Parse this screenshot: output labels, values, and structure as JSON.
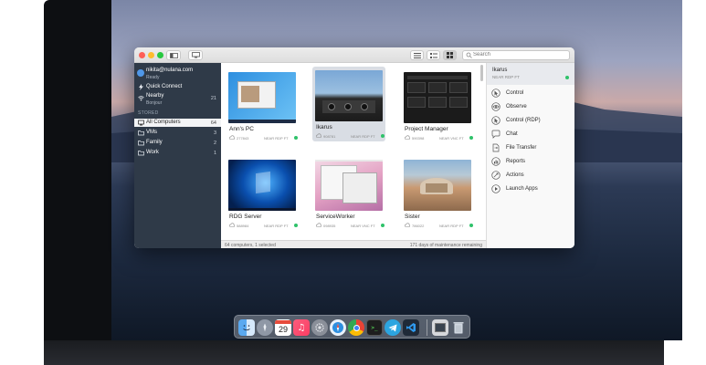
{
  "window": {
    "search_placeholder": "Search"
  },
  "sidebar": {
    "account": {
      "email": "nikita@nulana.com",
      "status": "Ready"
    },
    "quick_connect": "Quick Connect",
    "nearby": {
      "label": "Nearby",
      "sub": "Bonjour",
      "count": "21"
    },
    "section_label": "STORED",
    "items": [
      {
        "label": "All Computers",
        "count": "64",
        "selected": true
      },
      {
        "label": "VMs",
        "count": "3",
        "selected": false
      },
      {
        "label": "Family",
        "count": "2",
        "selected": false
      },
      {
        "label": "Work",
        "count": "1",
        "selected": false
      }
    ]
  },
  "computers": [
    {
      "name": "Ann's PC",
      "id": "277843",
      "connection": "NEAR RDP FT",
      "selected": false
    },
    {
      "name": "Ikarus",
      "id": "908781",
      "connection": "NEAR RDP FT",
      "selected": true
    },
    {
      "name": "Project Manager",
      "id": "590398",
      "connection": "NEAR VNC FT",
      "selected": false
    },
    {
      "name": "RDG Server",
      "id": "588984",
      "connection": "NEAR RDP FT",
      "selected": false
    },
    {
      "name": "ServiceWorker",
      "id": "098935",
      "connection": "NEAR VNC FT",
      "selected": false
    },
    {
      "name": "Sister",
      "id": "786022",
      "connection": "NEAR RDP FT",
      "selected": false
    }
  ],
  "status": {
    "left": "64 computers, 1 selected",
    "right": "171 days of maintenance remaining"
  },
  "detail": {
    "name": "Ikarus",
    "sub": "NEAR RDP FT",
    "actions": [
      {
        "label": "Control",
        "icon": "control-icon"
      },
      {
        "label": "Observe",
        "icon": "eye-icon"
      },
      {
        "label": "Control (RDP)",
        "icon": "rdp-control-icon"
      },
      {
        "label": "Chat",
        "icon": "chat-bubble-icon"
      },
      {
        "label": "File Transfer",
        "icon": "file-transfer-icon"
      },
      {
        "label": "Reports",
        "icon": "reports-icon"
      },
      {
        "label": "Actions",
        "icon": "actions-icon"
      },
      {
        "label": "Launch Apps",
        "icon": "play-icon"
      }
    ]
  },
  "dock": {
    "calendar_day": "29",
    "apps": [
      "finder-icon",
      "launchpad-icon",
      "calendar-icon",
      "music-icon",
      "system-preferences-icon",
      "safari-icon",
      "chrome-icon",
      "terminal-icon",
      "telegram-icon",
      "vscode-icon",
      "remote-desktop-icon",
      "trash-icon"
    ]
  },
  "colors": {
    "sidebar_bg": "#2f3a48",
    "online_dot": "#2fc26a",
    "accent": "#4f97e8"
  }
}
